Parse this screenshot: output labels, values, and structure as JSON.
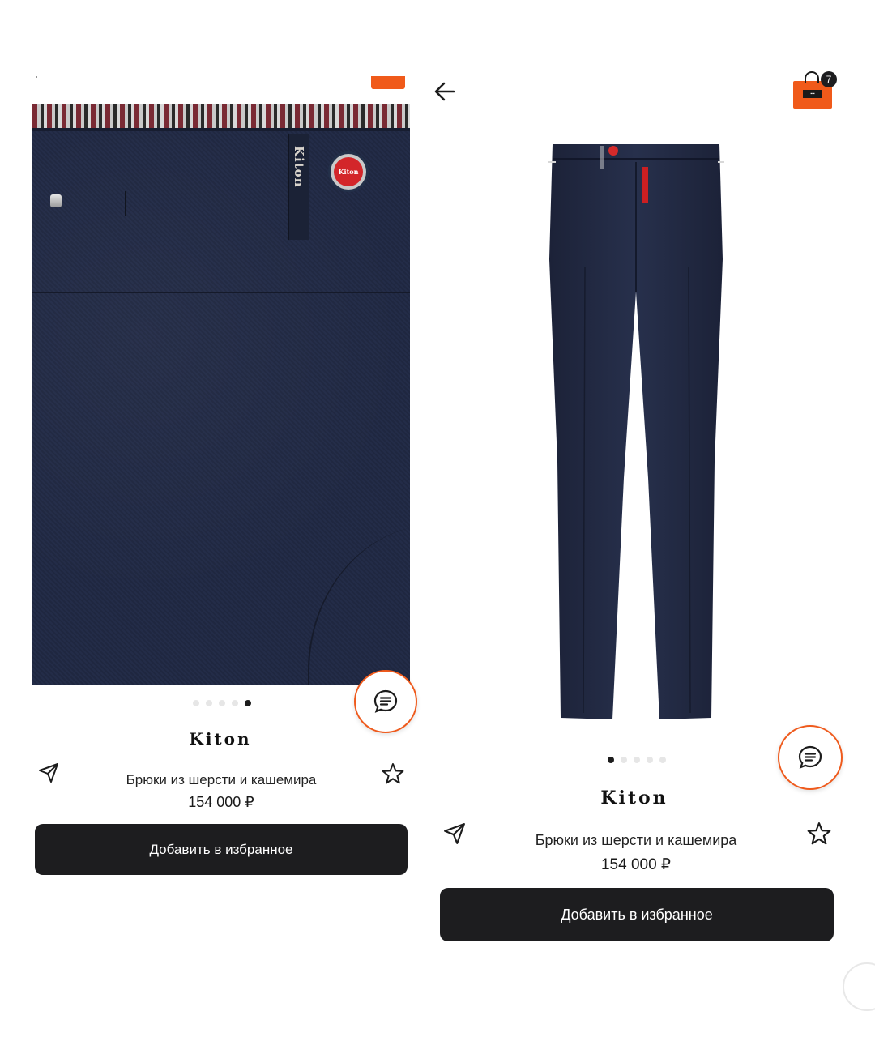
{
  "left_screen": {
    "brand": "Kiton",
    "product_name": "Брюки из шерсти и кашемира",
    "price": "154 000 ₽",
    "cta_label": "Добавить в избранное",
    "carousel": {
      "count": 5,
      "active_index": 4
    },
    "loop_brand_text": "Kiton",
    "button_brand_text": "Kiton"
  },
  "right_screen": {
    "brand": "Kiton",
    "product_name": "Брюки из шерсти и кашемира",
    "price": "154 000 ₽",
    "cta_label": "Добавить в избранное",
    "carousel": {
      "count": 5,
      "active_index": 0
    },
    "bag_badge_count": "7"
  },
  "icons": {
    "back": "arrow-left-icon",
    "share": "send-icon",
    "favorite": "star-icon",
    "chat": "chat-icon",
    "bag": "shopping-bag-icon"
  },
  "colors": {
    "accent": "#ef5a1c",
    "button_bg": "#1d1d1f",
    "fabric": "#232b45"
  }
}
